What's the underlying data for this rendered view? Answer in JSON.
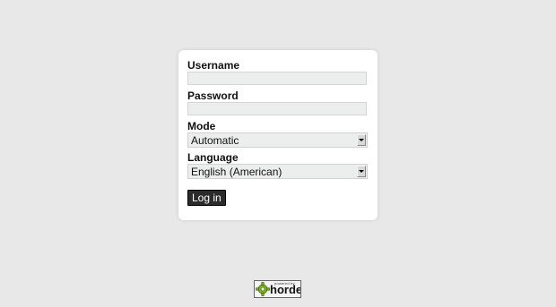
{
  "form": {
    "username_label": "Username",
    "username_value": "",
    "password_label": "Password",
    "password_value": "",
    "mode_label": "Mode",
    "mode_selected": "Automatic",
    "language_label": "Language",
    "language_selected": "English (American)",
    "login_button": "Log in"
  },
  "footer": {
    "logo_tagline": "powered by",
    "logo_word": "horde",
    "logo_gear_icon": "gear-icon"
  },
  "colors": {
    "page_background": "#e8e8e8",
    "input_background": "#eceeed",
    "button_background": "#2b2b2b",
    "logo_green": "#7cb518"
  }
}
